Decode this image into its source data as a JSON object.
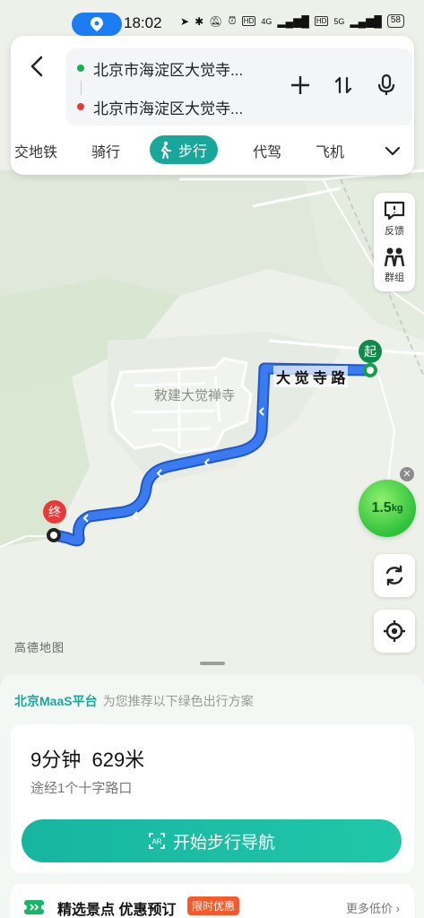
{
  "status_bar": {
    "time": "18:02",
    "battery": "58",
    "net1": "4G",
    "net2": "5G",
    "hd1": "HD",
    "hd2": "HD"
  },
  "route": {
    "origin": "北京市海淀区大觉寺...",
    "destination": "北京市海淀区大觉寺...",
    "origin_color": "#17b34b",
    "destination_color": "#e83a3a"
  },
  "modes": {
    "items": [
      "交地铁",
      "骑行",
      "步行",
      "代驾",
      "飞机"
    ],
    "active": "步行"
  },
  "map": {
    "road_label": "大 觉 寺 路",
    "poi_label": "敕建大觉禅寺",
    "start_marker": "起",
    "end_marker": "终",
    "brand": "高德地图",
    "route_color": "#3a7bef"
  },
  "side_buttons": {
    "feedback": "反馈",
    "group": "群组"
  },
  "carbon": {
    "value": "1.5",
    "unit": "kg"
  },
  "sheet": {
    "maas_brand": "北京MaaS平台",
    "maas_text": "为您推荐以下绿色出行方案",
    "duration": "9分钟",
    "distance": "629米",
    "via": "途经1个十字路口",
    "start_button": "开始步行导航",
    "promo_title": "精选景点 优惠预订",
    "promo_badge": "限时优惠",
    "promo_more": "更多低价 ›"
  }
}
